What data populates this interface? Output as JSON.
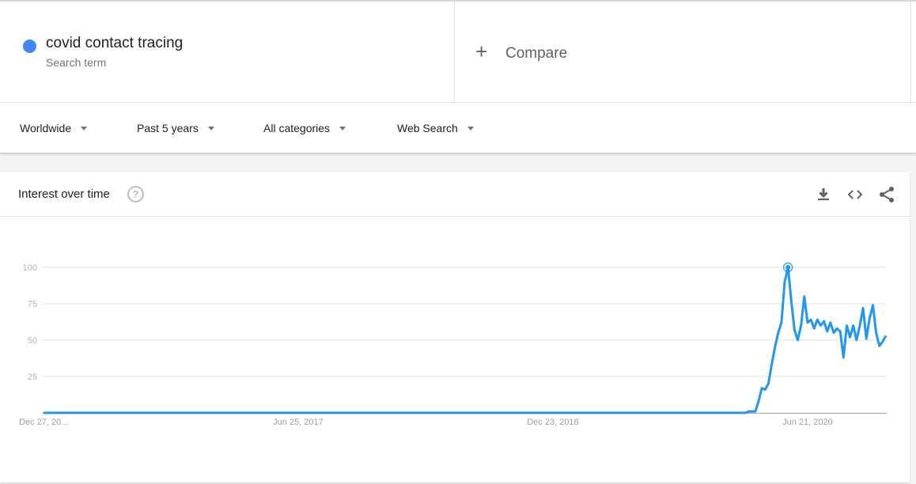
{
  "search_term": {
    "name": "covid contact tracing",
    "type_label": "Search term",
    "color": "#4285f4"
  },
  "compare": {
    "label": "Compare",
    "icon": "plus-icon"
  },
  "filters": [
    {
      "label": "Worldwide"
    },
    {
      "label": "Past 5 years"
    },
    {
      "label": "All categories"
    },
    {
      "label": "Web Search"
    }
  ],
  "card": {
    "title": "Interest over time",
    "help_icon": "help-icon",
    "actions": [
      "download-icon",
      "embed-icon",
      "share-icon"
    ]
  },
  "chart_data": {
    "type": "line",
    "title": "Interest over time",
    "xlabel": "",
    "ylabel": "",
    "ylim": [
      0,
      100
    ],
    "yticks": [
      25,
      50,
      75,
      100
    ],
    "xtick_labels": [
      "Dec 27, 20...",
      "Jun 25, 2017",
      "Dec 23, 2018",
      "Jun 21, 2020"
    ],
    "grid": true,
    "line_color": "#2196f3",
    "highlight": {
      "label": "peak",
      "value": 100
    },
    "series": [
      {
        "name": "covid contact tracing",
        "zero_weeks_before_rise": 216,
        "values": [
          1,
          1,
          1,
          8,
          17,
          16,
          20,
          33,
          45,
          55,
          62,
          90,
          100,
          77,
          57,
          50,
          60,
          80,
          62,
          64,
          58,
          64,
          60,
          63,
          56,
          62,
          55,
          58,
          56,
          38,
          60,
          52,
          60,
          50,
          60,
          72,
          51,
          65,
          74,
          55,
          46,
          49,
          53
        ]
      }
    ]
  }
}
